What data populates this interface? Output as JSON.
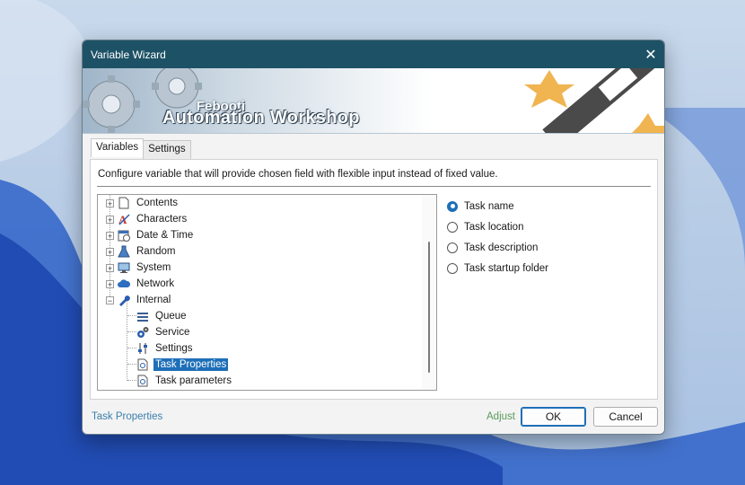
{
  "window": {
    "title": "Variable Wizard",
    "close_glyph": "✕"
  },
  "banner": {
    "small_text": "Febooti",
    "big_text": "Automation Workshop"
  },
  "tabs": [
    {
      "label": "Variables",
      "active": true
    },
    {
      "label": "Settings",
      "active": false
    }
  ],
  "description": "Configure variable that will provide chosen field with flexible input instead of fixed value.",
  "tree": {
    "items": [
      {
        "label": "Contents",
        "icon": "document-icon",
        "expander": "+"
      },
      {
        "label": "Characters",
        "icon": "characters-icon",
        "expander": "+"
      },
      {
        "label": "Date & Time",
        "icon": "calendar-icon",
        "expander": "+"
      },
      {
        "label": "Random",
        "icon": "flask-icon",
        "expander": "+"
      },
      {
        "label": "System",
        "icon": "monitor-icon",
        "expander": "+"
      },
      {
        "label": "Network",
        "icon": "cloud-icon",
        "expander": "+"
      },
      {
        "label": "Internal",
        "icon": "wrench-icon",
        "expander": "−"
      }
    ],
    "children": [
      {
        "label": "Queue",
        "icon": "queue-icon"
      },
      {
        "label": "Service",
        "icon": "gears-icon"
      },
      {
        "label": "Settings",
        "icon": "sliders-icon"
      },
      {
        "label": "Task Properties",
        "icon": "task-doc-icon",
        "selected": true
      },
      {
        "label": "Task parameters",
        "icon": "task-doc-icon"
      }
    ]
  },
  "options": [
    {
      "label": "Task name",
      "checked": true
    },
    {
      "label": "Task location",
      "checked": false
    },
    {
      "label": "Task description",
      "checked": false
    },
    {
      "label": "Task startup folder",
      "checked": false
    }
  ],
  "footer": {
    "link": "Task Properties",
    "adjust": "Adjust",
    "ok": "OK",
    "cancel": "Cancel"
  }
}
